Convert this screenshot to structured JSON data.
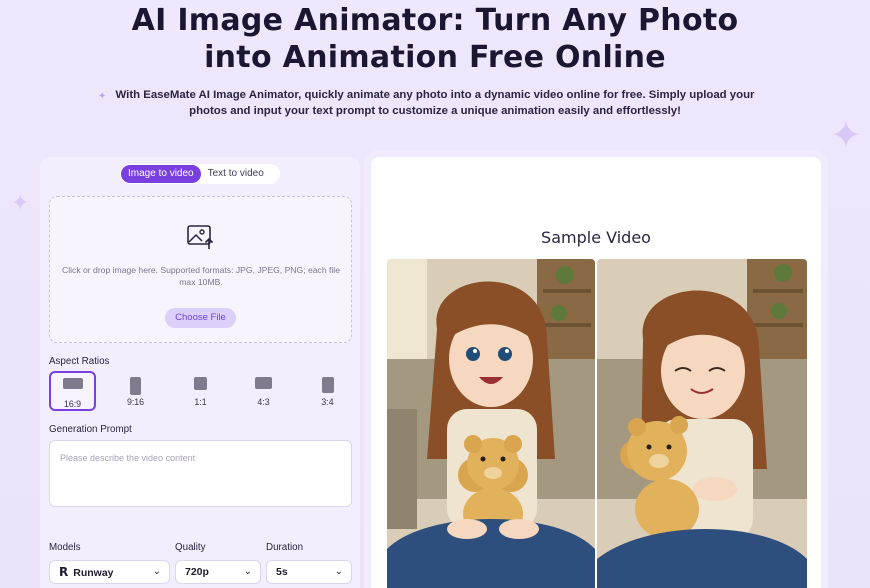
{
  "hero": {
    "title_line1": "AI Image Animator: Turn Any Photo",
    "title_line2": "into Animation Free Online",
    "subtitle": "With EaseMate AI Image Animator, quickly animate any photo into a dynamic video online for free. Simply upload your photos and input your text prompt to customize a unique animation easily and effortlessly!"
  },
  "tabs": [
    {
      "label": "Image to video",
      "active": true
    },
    {
      "label": "Text to video",
      "active": false
    }
  ],
  "upload": {
    "icon": "image-upload-icon",
    "hint": "Click or drop image here. Supported formats: JPG, JPEG, PNG; each file max 10MB.",
    "button": "Choose File"
  },
  "aspect": {
    "label": "Aspect Ratios",
    "options": [
      {
        "label": "16:9",
        "active": true
      },
      {
        "label": "9:16",
        "active": false
      },
      {
        "label": "1:1",
        "active": false
      },
      {
        "label": "4:3",
        "active": false
      },
      {
        "label": "3:4",
        "active": false
      }
    ]
  },
  "prompt": {
    "label": "Generation Prompt",
    "placeholder": "Please describe the video content"
  },
  "settings": {
    "models_label": "Models",
    "model_value": "Runway",
    "quality_label": "Quality",
    "quality_value": "720p",
    "duration_label": "Duration",
    "duration_value": "5s"
  },
  "sample": {
    "title": "Sample Video"
  },
  "colors": {
    "accent": "#7a3fe0",
    "background": "#efe7fb",
    "button_soft": "#dccffa"
  }
}
